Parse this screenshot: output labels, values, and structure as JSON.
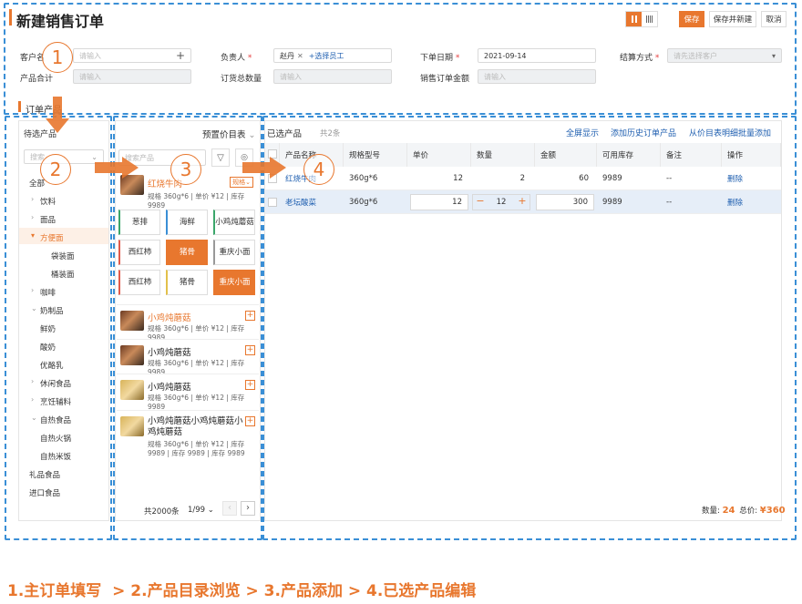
{
  "header": {
    "title": "新建销售订单",
    "save": "保存",
    "save_new": "保存并新建",
    "cancel": "取消"
  },
  "form": {
    "customer_label": "客户名",
    "customer_placeholder": "请输入",
    "owner_label": "负责人",
    "owner_tag": "赵丹",
    "owner_add": "+选择员工",
    "date_label": "下单日期",
    "date_value": "2021-09-14",
    "settle_label": "结算方式",
    "settle_placeholder": "请先选择客户",
    "product_total_label": "产品合计",
    "product_total_placeholder": "请输入",
    "total_qty_label": "订货总数量",
    "total_qty_placeholder": "请输入",
    "amount_label": "销售订单金额",
    "amount_placeholder": "请输入",
    "section_title": "订单产品"
  },
  "categories": {
    "title": "待选产品",
    "search_placeholder": "搜索",
    "items": [
      "全部",
      "饮料",
      "面品",
      "方便面",
      "袋装面",
      "桶装面",
      "咖啡",
      "奶制品",
      "鲜奶",
      "酸奶",
      "优酪乳",
      "休闲食品",
      "烹饪辅料",
      "自热食品",
      "自热火锅",
      "自热米饭",
      "礼品食品",
      "进口食品"
    ]
  },
  "catalog": {
    "title": "预置价目表",
    "search_placeholder": "搜索产品",
    "first": {
      "name": "红烧牛肉",
      "spec_tag": "规格",
      "meta": "规格 360g*6 | 单价 ¥12 | 库存 9989"
    },
    "tiles": [
      "葱排",
      "海鲜",
      "小鸡炖蘑菇",
      "西红柿",
      "猪骨",
      "重庆小面",
      "西红柿",
      "猪骨",
      "重庆小面"
    ],
    "products": [
      {
        "name": "小鸡炖蘑菇",
        "meta": "规格 360g*6 | 单价 ¥12 | 库存 9989"
      },
      {
        "name": "小鸡炖蘑菇",
        "meta": "规格 360g*6 | 单价 ¥12 | 库存 9989"
      },
      {
        "name": "小鸡炖蘑菇",
        "meta": "规格 360g*6 | 单价 ¥12 | 库存 9989"
      },
      {
        "name": "小鸡炖蘑菇小鸡炖蘑菇小鸡炖蘑菇",
        "meta": "规格 360g*6 | 单价 ¥12 | 库存 9989 | 库存 9989 | 库存 9989"
      }
    ],
    "footer_total": "共2000条",
    "page": "1/99"
  },
  "selected": {
    "title": "已选产品",
    "count": "共2条",
    "full_screen": "全屏显示",
    "add_history": "添加历史订单产品",
    "batch_add": "从价目表明细批量添加",
    "columns": [
      "产品名称",
      "规格型号",
      "单价",
      "数量",
      "金额",
      "可用库存",
      "备注",
      "操作"
    ],
    "rows": [
      {
        "name": "红烧牛肉",
        "spec": "360g*6",
        "price": "12",
        "qty": "2",
        "amount": "60",
        "stock": "9989",
        "note": "--",
        "op": "删除"
      },
      {
        "name": "老坛酸菜",
        "spec": "360g*6",
        "price": "12",
        "qty": "12",
        "amount": "300",
        "stock": "9989",
        "note": "--",
        "op": "删除"
      }
    ],
    "qty_label": "数量:",
    "qty_value": "24",
    "total_label": "总价:",
    "total_value": "¥360"
  },
  "steps": [
    "1",
    "2",
    "3",
    "4"
  ],
  "caption": "1.主订单填写  > 2.产品目录浏览 > 3.产品添加 > 4.已选产品编辑"
}
